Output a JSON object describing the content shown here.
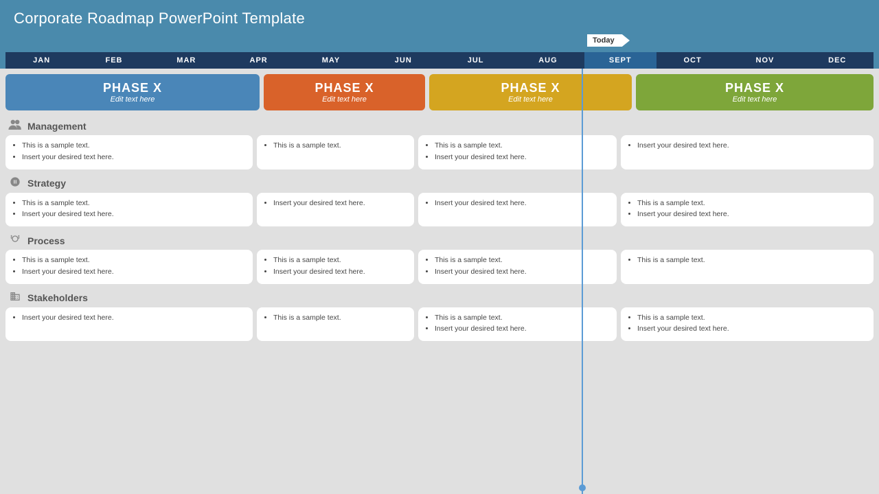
{
  "title": "Corporate Roadmap PowerPoint Template",
  "today_label": "Today",
  "months": [
    {
      "label": "JAN",
      "highlight": false
    },
    {
      "label": "FEB",
      "highlight": false
    },
    {
      "label": "MAR",
      "highlight": false
    },
    {
      "label": "APR",
      "highlight": false
    },
    {
      "label": "MAY",
      "highlight": false
    },
    {
      "label": "JUN",
      "highlight": false
    },
    {
      "label": "JUL",
      "highlight": false
    },
    {
      "label": "AUG",
      "highlight": false
    },
    {
      "label": "SEPT",
      "highlight": true
    },
    {
      "label": "OCT",
      "highlight": false
    },
    {
      "label": "NOV",
      "highlight": false
    },
    {
      "label": "DEC",
      "highlight": false
    }
  ],
  "phases": [
    {
      "title": "PHASE X",
      "subtitle": "Edit text here",
      "color": "blue"
    },
    {
      "title": "PHASE X",
      "subtitle": "Edit text here",
      "color": "orange"
    },
    {
      "title": "PHASE X",
      "subtitle": "Edit text here",
      "color": "yellow"
    },
    {
      "title": "PHASE X",
      "subtitle": "Edit text here",
      "color": "green"
    }
  ],
  "sections": [
    {
      "title": "Management",
      "icon": "👥",
      "cards": [
        {
          "items": [
            "This is a sample text.",
            "Insert your desired text here."
          ]
        },
        {
          "items": [
            "This is a sample text."
          ]
        },
        {
          "items": [
            "This is a sample text.",
            "Insert your desired text here."
          ]
        },
        {
          "items": [
            "Insert your desired text here."
          ]
        }
      ]
    },
    {
      "title": "Strategy",
      "icon": "🔧",
      "cards": [
        {
          "items": [
            "This is a sample text.",
            "Insert your desired text here."
          ]
        },
        {
          "items": [
            "Insert your desired text here."
          ]
        },
        {
          "items": [
            "Insert your desired text here."
          ]
        },
        {
          "items": [
            "This is a sample text.",
            "Insert your desired text here."
          ]
        }
      ]
    },
    {
      "title": "Process",
      "icon": "🔄",
      "cards": [
        {
          "items": [
            "This is a sample text.",
            "Insert your desired text here."
          ]
        },
        {
          "items": [
            "This is a sample text.",
            "Insert your desired text here."
          ]
        },
        {
          "items": [
            "This is a sample text.",
            "Insert your desired text here."
          ]
        },
        {
          "items": [
            "This is a sample text."
          ]
        }
      ]
    },
    {
      "title": "Stakeholders",
      "icon": "🏛",
      "cards": [
        {
          "items": [
            "Insert your desired text here."
          ]
        },
        {
          "items": [
            "This is a sample text."
          ]
        },
        {
          "items": [
            "This is a sample text.",
            "Insert your desired text here."
          ]
        },
        {
          "items": [
            "This is a sample text.",
            "Insert your desired text here."
          ]
        }
      ]
    }
  ]
}
